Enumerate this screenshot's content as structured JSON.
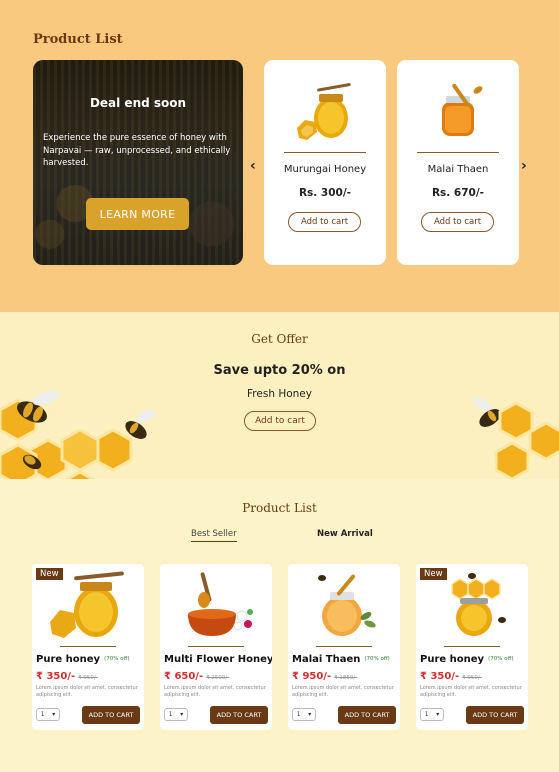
{
  "top_section": {
    "title": "Product List",
    "hero": {
      "heading": "Deal end soon",
      "text": "Experience the pure essence of honey with Narpavai — raw, unprocessed, and ethically harvested.",
      "button": "LEARN MORE"
    },
    "prev_icon": "chevron-left-icon",
    "next_icon": "chevron-right-icon",
    "products": [
      {
        "name": "Murungai Honey",
        "price": "Rs. 300/-",
        "button": "Add to cart"
      },
      {
        "name": "Malai Thaen",
        "price": "Rs. 670/-",
        "button": "Add to cart"
      }
    ]
  },
  "offer": {
    "title": "Get Offer",
    "headline": "Save upto 20% on",
    "subline": "Fresh Honey",
    "button": "Add to cart"
  },
  "product_list": {
    "title": "Product List",
    "tabs": [
      "Best Seller",
      "New Arrival"
    ],
    "items": [
      {
        "badge": "New",
        "name": "Pure honey",
        "off": "(70% off)",
        "price": "₹ 350/-",
        "old": "₹ 950/-",
        "desc": "Lorem ipsum dolor sit amet, consectetur adipiscing elit.",
        "qty": "1",
        "button": "ADD TO CART"
      },
      {
        "badge": "",
        "name": "Multi Flower Honey",
        "off": "",
        "price": "₹ 650/-",
        "old": "₹ 2500/-",
        "desc": "Lorem ipsum dolor sit amet, consectetur adipiscing elit.",
        "qty": "1",
        "button": "ADD TO CART"
      },
      {
        "badge": "",
        "name": "Malai Thaen",
        "off": "(70% off)",
        "price": "₹ 950/-",
        "old": "₹ 1850/-",
        "desc": "Lorem ipsum dolor sit amet, consectetur adipiscing elit.",
        "qty": "1",
        "button": "ADD TO CART"
      },
      {
        "badge": "New",
        "name": "Pure honey",
        "off": "(70% off)",
        "price": "₹ 350/-",
        "old": "₹ 950/-",
        "desc": "Lorem ipsum dolor sit amet, consectetur adipiscing elit.",
        "qty": "1",
        "button": "ADD TO CART"
      }
    ]
  },
  "colors": {
    "brown": "#6b3a14",
    "gold": "#d9a32b",
    "peach": "#f8c97e",
    "cream": "#fdf3c8",
    "price_red": "#d32f2f",
    "off_green": "#2e7d32"
  }
}
